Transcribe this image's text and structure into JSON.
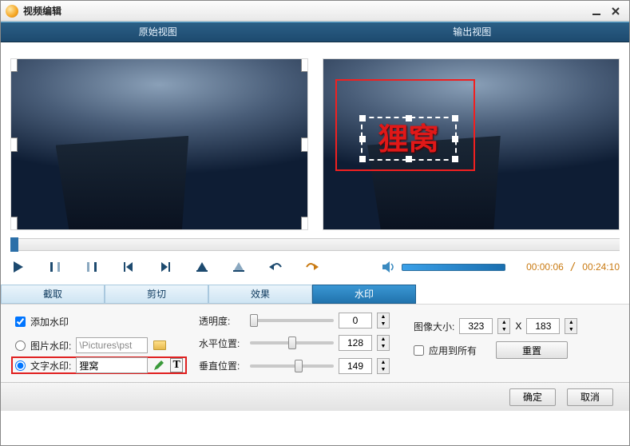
{
  "window": {
    "title": "视频编辑"
  },
  "views": {
    "original": "原始视图",
    "output": "输出视图"
  },
  "watermark_text": "狸窝",
  "time": {
    "current": "00:00:06",
    "total": "00:24:10"
  },
  "tabs": {
    "crop": "截取",
    "cut": "剪切",
    "effect": "效果",
    "watermark": "水印"
  },
  "wm_panel": {
    "add_watermark": "添加水印",
    "image_watermark": "图片水印:",
    "image_path": "\\Pictures\\pst",
    "text_watermark": "文字水印:",
    "text_value": "狸窝",
    "opacity": "透明度:",
    "hpos": "水平位置:",
    "vpos": "垂直位置:",
    "opacity_val": "0",
    "hpos_val": "128",
    "vpos_val": "149",
    "image_size": "图像大小:",
    "w": "323",
    "h": "183",
    "x": "X",
    "apply_all": "应用到所有",
    "reset": "重置"
  },
  "footer": {
    "ok": "确定",
    "cancel": "取消"
  }
}
